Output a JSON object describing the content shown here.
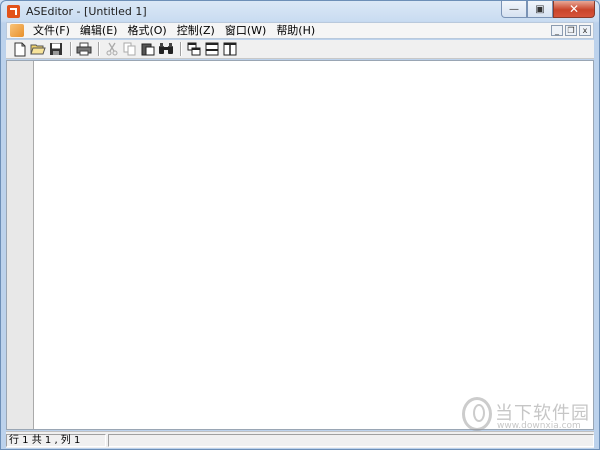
{
  "window": {
    "title": "ASEditor - [Untitled 1]"
  },
  "caption_buttons": {
    "minimize": "—",
    "maximize": "▣",
    "close": "✕"
  },
  "menu": {
    "items": [
      "文件(F)",
      "编辑(E)",
      "格式(O)",
      "控制(Z)",
      "窗口(W)",
      "帮助(H)"
    ],
    "mdi_buttons": {
      "minimize": "_",
      "restore": "❐",
      "close": "x"
    }
  },
  "toolbar": {
    "buttons": [
      "new-document-icon",
      "open-folder-icon",
      "save-icon",
      "print-icon",
      "cut-icon",
      "copy-icon",
      "paste-icon",
      "find-icon",
      "cascade-windows-icon",
      "tile-horizontal-icon",
      "tile-vertical-icon"
    ]
  },
  "statusbar": {
    "position": "行 1 共 1 , 列 1"
  },
  "watermark": {
    "brand": "当下软件园",
    "url": "www.downxia.com"
  },
  "colors": {
    "accent_orange": "#e2531a",
    "close_red": "#c9442b",
    "title_bar": "#c9dcf1"
  }
}
